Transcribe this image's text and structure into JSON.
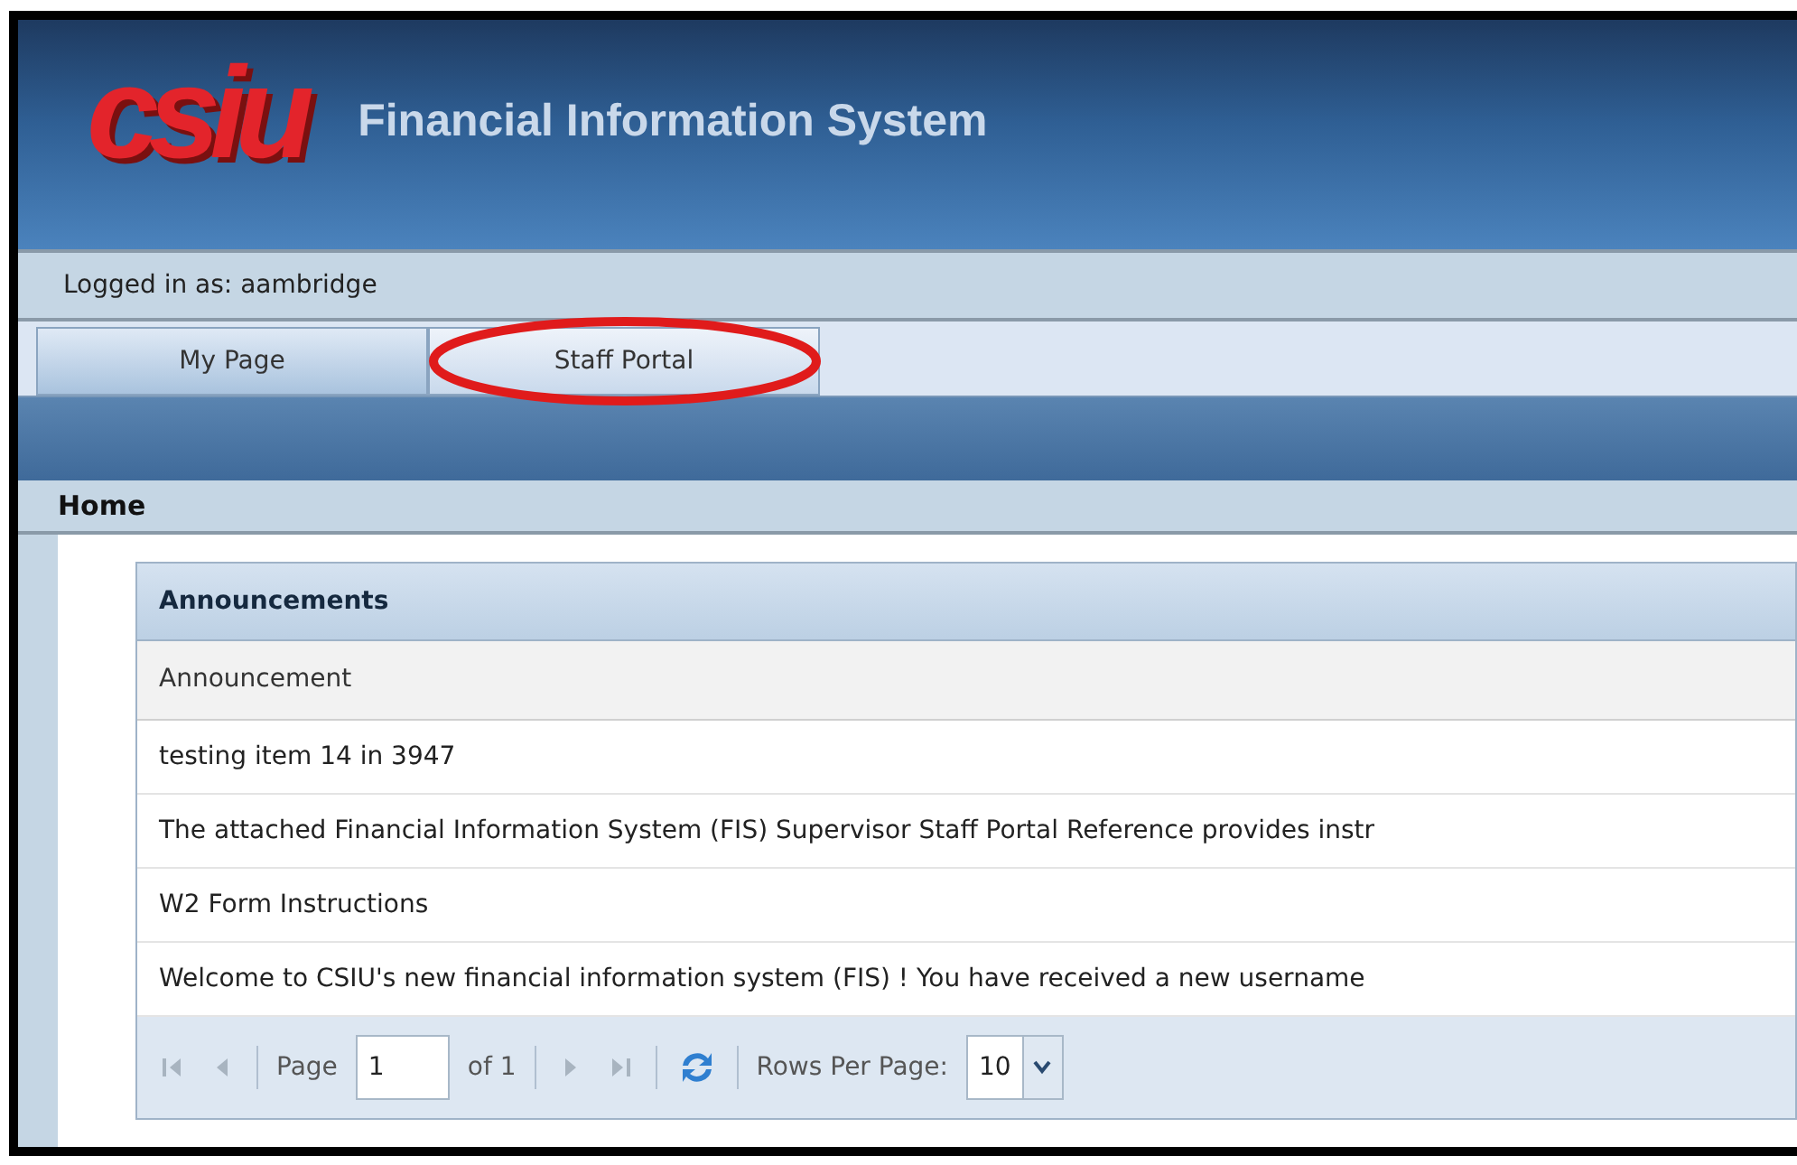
{
  "header": {
    "logo": "csiu",
    "title": "Financial Information System"
  },
  "user_bar": {
    "text": "Logged in as: aambridge"
  },
  "tabs": [
    {
      "label": "My Page",
      "selected": true,
      "circled": false
    },
    {
      "label": "Staff Portal",
      "selected": false,
      "circled": true
    }
  ],
  "breadcrumb": "Home",
  "panel": {
    "title": "Announcements",
    "columns": [
      "Announcement"
    ],
    "rows": [
      {
        "text": "testing item 14 in 3947"
      },
      {
        "text": "The attached Financial Information System (FIS) Supervisor Staff Portal Reference provides instr"
      },
      {
        "text": "W2 Form Instructions"
      },
      {
        "text": "Welcome to CSIU's new financial information system (FIS) ! You have received a new username"
      }
    ],
    "pager": {
      "page_label": "Page",
      "page_value": "1",
      "of_label": "of 1",
      "rows_label": "Rows Per Page:",
      "rows_value": "10",
      "first_disabled": true,
      "prev_disabled": true,
      "next_disabled": true,
      "last_disabled": true
    }
  }
}
